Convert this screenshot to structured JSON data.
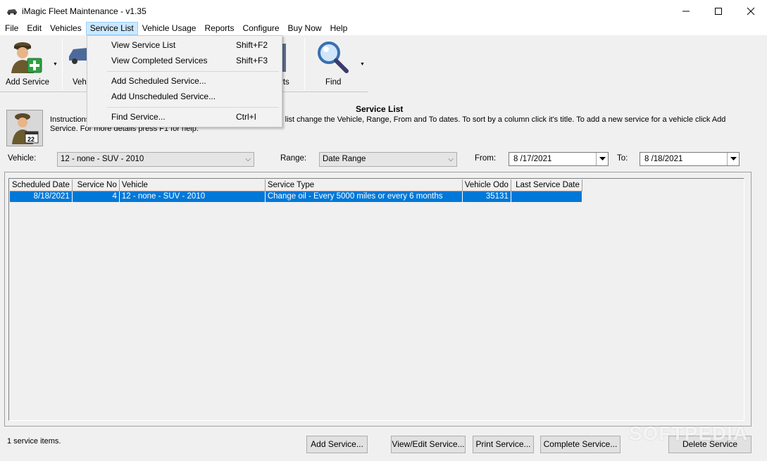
{
  "window": {
    "title": "iMagic Fleet Maintenance - v1.35"
  },
  "menu": {
    "items": [
      "File",
      "Edit",
      "Vehicles",
      "Service List",
      "Vehicle Usage",
      "Reports",
      "Configure",
      "Buy Now",
      "Help"
    ]
  },
  "toolbar": {
    "add_service": "Add Service",
    "vehicles_partial": "Vehi",
    "reports_partial": "rts",
    "find": "Find"
  },
  "dropdown": {
    "items": [
      {
        "label": "View Service List",
        "shortcut": "Shift+F2"
      },
      {
        "label": "View Completed Services",
        "shortcut": "Shift+F3"
      },
      {
        "label": "Add Scheduled Service...",
        "shortcut": ""
      },
      {
        "label": "Add Unscheduled Service...",
        "shortcut": ""
      },
      {
        "label": "Find Service...",
        "shortcut": "Ctrl+I"
      }
    ]
  },
  "main": {
    "heading": "Service List",
    "instructions_line1_start": "Instructions",
    "instructions_line1_end": "he list change the Vehicle, Range, From and To dates.  To sort by a column click it's title. To add a new service for a vehicle click Add",
    "instructions_line2": "Service. For more details press F1 for help."
  },
  "filters": {
    "vehicle_label": "Vehicle:",
    "vehicle_value": "12 - none - SUV - 2010",
    "range_label": "Range:",
    "range_value": "Date Range",
    "from_label": "From:",
    "from_value": "8 /17/2021",
    "to_label": "To:",
    "to_value": "8 /18/2021"
  },
  "grid": {
    "columns": [
      "Scheduled Date",
      "Service No",
      "Vehicle",
      "Service Type",
      "Vehicle Odo",
      "Last Service Date"
    ],
    "rows": [
      [
        "8/18/2021",
        "4",
        "12 - none - SUV - 2010",
        "Change oil - Every 5000 miles or every 6 months",
        "35131",
        ""
      ]
    ]
  },
  "status": {
    "text": "1 service items."
  },
  "buttons": {
    "add": "Add Service...",
    "view_edit": "View/Edit Service...",
    "print": "Print Service...",
    "complete": "Complete Service...",
    "delete": "Delete Service"
  },
  "watermark": "SOFTPEDIA",
  "colors": {
    "selection": "#0078d7",
    "menu_highlight": "#cce8ff"
  }
}
